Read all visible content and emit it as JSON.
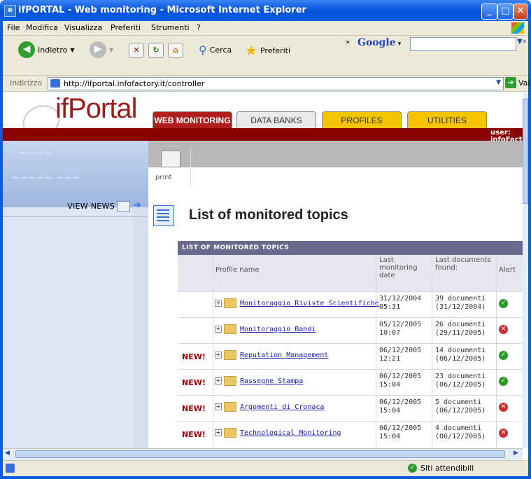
{
  "window": {
    "title": "ifPORTAL - Web monitoring - Microsoft Internet Explorer"
  },
  "menu": [
    "File",
    "Modifica",
    "Visualizza",
    "Preferiti",
    "Strumenti",
    "?"
  ],
  "toolbar": {
    "back": "Indietro",
    "search": "Cerca",
    "favorites": "Preferiti",
    "google": "Google"
  },
  "address": {
    "label": "Indirizzo",
    "url": "http://ifportal.infofactory.it/controller",
    "go": "Vai"
  },
  "site": {
    "logo": "ifPortal",
    "tabs": [
      "WEB MONITORING",
      "DATA BANKS",
      "PROFILES",
      "UTILITIES"
    ],
    "user": "user: infoFact test",
    "print": "print",
    "view_news": "VIEW NEWS",
    "page_title": "List of monitored topics"
  },
  "table": {
    "caption": "LIST OF MONITORED TOPICS",
    "headers": {
      "profile": "Profile name",
      "last_date": "Last monitoring date",
      "last_docs": "Last documents found:",
      "alert": "Alert"
    },
    "rows": [
      {
        "new": "",
        "name": "Monitoraggio Riviste Scientifiche",
        "date": "31/12/2004",
        "time": "05:31",
        "docs": "39 documenti",
        "docs_date": "(31/12/2004)",
        "alert": "ok"
      },
      {
        "new": "",
        "name": "Monitoraggio Bandi",
        "date": "05/12/2005",
        "time": "10:07",
        "docs": "26 documenti",
        "docs_date": "(29/11/2005)",
        "alert": "error"
      },
      {
        "new": "NEW!",
        "name": "Reputation Management",
        "date": "06/12/2005",
        "time": "12:21",
        "docs": "14 documenti",
        "docs_date": "(06/12/2005)",
        "alert": "ok"
      },
      {
        "new": "NEW!",
        "name": "Rassegne Stampa",
        "date": "06/12/2005",
        "time": "15:04",
        "docs": "23 documenti",
        "docs_date": "(06/12/2005)",
        "alert": "ok"
      },
      {
        "new": "NEW!",
        "name": "Argomenti di Cronaca",
        "date": "06/12/2005",
        "time": "15:04",
        "docs": "5 documenti",
        "docs_date": "(06/12/2005)",
        "alert": "error"
      },
      {
        "new": "NEW!",
        "name": "Technological Monitoring",
        "date": "06/12/2005",
        "time": "15:04",
        "docs": "4 documenti",
        "docs_date": "(06/12/2005)",
        "alert": "error"
      }
    ]
  },
  "status": {
    "zone": "Siti attendibili"
  },
  "colors": {
    "brand_red": "#8b0000",
    "tab_active": "#b01e1e",
    "tab_yellow": "#f5c400",
    "header_bar": "#6a6a8e"
  }
}
